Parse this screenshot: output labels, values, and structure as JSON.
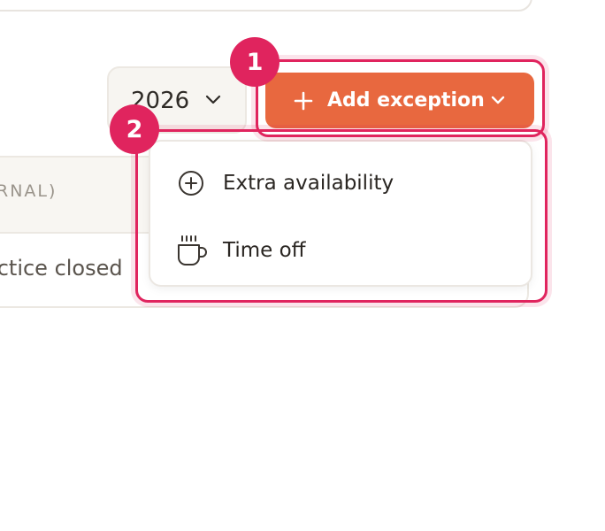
{
  "year_select": {
    "value": "2026"
  },
  "add_exception_button": {
    "label": "Add exception"
  },
  "table": {
    "header_partial": "ERNAL)",
    "row_partial": "actice closed"
  },
  "dropdown_menu": {
    "items": [
      {
        "label": "Extra availability",
        "icon": "plus-circle-icon"
      },
      {
        "label": "Time off",
        "icon": "coffee-cup-icon"
      }
    ]
  },
  "callouts": [
    {
      "number": "1"
    },
    {
      "number": "2"
    }
  ],
  "colors": {
    "accent": "#e8683f",
    "callout": "#e0245e"
  }
}
